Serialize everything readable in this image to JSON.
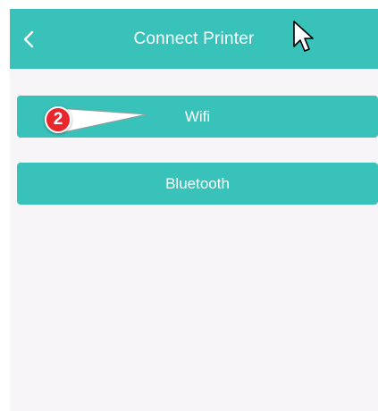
{
  "header": {
    "title": "Connect Printer",
    "back_icon": "chevron-left-icon"
  },
  "options": {
    "wifi_label": "Wifi",
    "bluetooth_label": "Bluetooth"
  },
  "annotation": {
    "step_number": "2"
  },
  "colors": {
    "accent": "#38c2b9",
    "background": "#f8f5f9",
    "badge": "#e8262c"
  }
}
